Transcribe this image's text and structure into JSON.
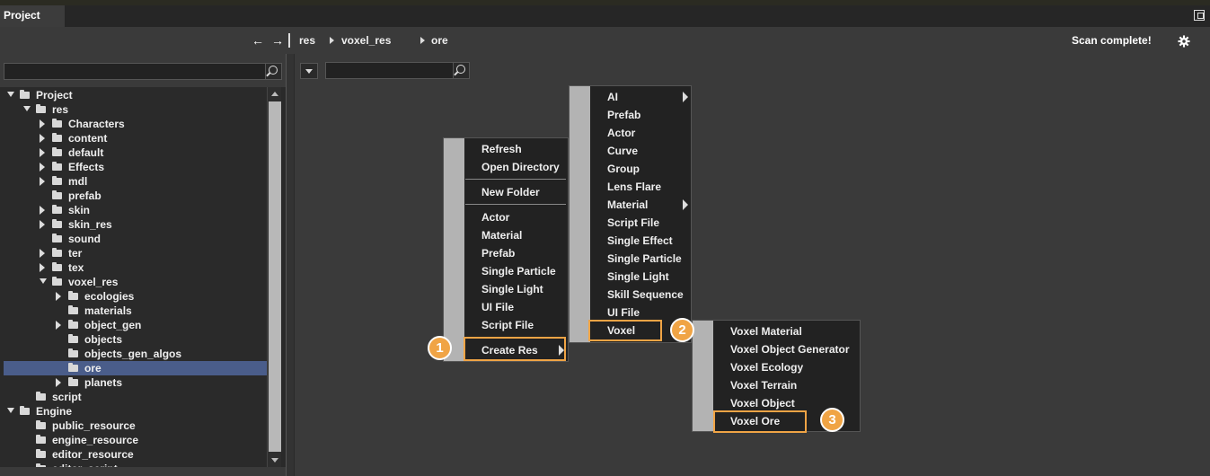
{
  "window": {
    "tab_label": "Project"
  },
  "navbar": {
    "back_glyph": "←",
    "forward_glyph": "→",
    "breadcrumb": [
      "res",
      "voxel_res",
      "ore"
    ],
    "status": "Scan complete!"
  },
  "left_panel": {
    "search_placeholder": "",
    "tree": [
      {
        "label": "Project",
        "depth": 0,
        "expand": "down",
        "folder": "open"
      },
      {
        "label": "res",
        "depth": 1,
        "expand": "down",
        "folder": "open"
      },
      {
        "label": "Characters",
        "depth": 2,
        "expand": "right",
        "folder": "closed"
      },
      {
        "label": "content",
        "depth": 2,
        "expand": "right",
        "folder": "closed"
      },
      {
        "label": "default",
        "depth": 2,
        "expand": "right",
        "folder": "closed"
      },
      {
        "label": "Effects",
        "depth": 2,
        "expand": "right",
        "folder": "closed"
      },
      {
        "label": "mdl",
        "depth": 2,
        "expand": "right",
        "folder": "closed"
      },
      {
        "label": "prefab",
        "depth": 2,
        "expand": "none",
        "folder": "closed"
      },
      {
        "label": "skin",
        "depth": 2,
        "expand": "right",
        "folder": "closed"
      },
      {
        "label": "skin_res",
        "depth": 2,
        "expand": "right",
        "folder": "closed"
      },
      {
        "label": "sound",
        "depth": 2,
        "expand": "none",
        "folder": "closed"
      },
      {
        "label": "ter",
        "depth": 2,
        "expand": "right",
        "folder": "closed"
      },
      {
        "label": "tex",
        "depth": 2,
        "expand": "right",
        "folder": "closed"
      },
      {
        "label": "voxel_res",
        "depth": 2,
        "expand": "down",
        "folder": "open"
      },
      {
        "label": "ecologies",
        "depth": 3,
        "expand": "right",
        "folder": "closed"
      },
      {
        "label": "materials",
        "depth": 3,
        "expand": "none",
        "folder": "closed"
      },
      {
        "label": "object_gen",
        "depth": 3,
        "expand": "right",
        "folder": "closed"
      },
      {
        "label": "objects",
        "depth": 3,
        "expand": "none",
        "folder": "closed"
      },
      {
        "label": "objects_gen_algos",
        "depth": 3,
        "expand": "none",
        "folder": "closed"
      },
      {
        "label": "ore",
        "depth": 3,
        "expand": "none",
        "folder": "open",
        "selected": true
      },
      {
        "label": "planets",
        "depth": 3,
        "expand": "right",
        "folder": "closed"
      },
      {
        "label": "script",
        "depth": 1,
        "expand": "none",
        "folder": "closed"
      },
      {
        "label": "Engine",
        "depth": 0,
        "expand": "down",
        "folder": "open"
      },
      {
        "label": "public_resource",
        "depth": 1,
        "expand": "none",
        "folder": "closed"
      },
      {
        "label": "engine_resource",
        "depth": 1,
        "expand": "none",
        "folder": "closed"
      },
      {
        "label": "editor_resource",
        "depth": 1,
        "expand": "none",
        "folder": "closed"
      },
      {
        "label": "editor_script",
        "depth": 1,
        "expand": "none",
        "folder": "closed"
      }
    ]
  },
  "right_panel": {
    "search_placeholder": ""
  },
  "context_menu": {
    "items": [
      {
        "label": "Refresh"
      },
      {
        "label": "Open Directory"
      },
      {
        "separator": true
      },
      {
        "label": "New Folder"
      },
      {
        "separator": true
      },
      {
        "label": "Actor"
      },
      {
        "label": "Material"
      },
      {
        "label": "Prefab"
      },
      {
        "label": "Single Particle"
      },
      {
        "label": "Single Light"
      },
      {
        "label": "UI File"
      },
      {
        "label": "Script File"
      },
      {
        "separator": true
      },
      {
        "label": "Create Res",
        "submenu": true
      }
    ]
  },
  "create_res_submenu": {
    "items": [
      {
        "label": "AI",
        "submenu": true
      },
      {
        "label": "Prefab"
      },
      {
        "label": "Actor"
      },
      {
        "label": "Curve"
      },
      {
        "label": "Group"
      },
      {
        "label": "Lens Flare"
      },
      {
        "label": "Material",
        "submenu": true
      },
      {
        "label": "Script File"
      },
      {
        "label": "Single Effect"
      },
      {
        "label": "Single Particle"
      },
      {
        "label": "Single Light"
      },
      {
        "label": "Skill Sequence"
      },
      {
        "label": "UI File"
      },
      {
        "label": "Voxel",
        "submenu": true
      }
    ]
  },
  "voxel_submenu": {
    "items": [
      {
        "label": "Voxel Material"
      },
      {
        "label": "Voxel Object Generator"
      },
      {
        "label": "Voxel Ecology"
      },
      {
        "label": "Voxel Terrain"
      },
      {
        "label": "Voxel Object"
      },
      {
        "label": "Voxel Ore"
      }
    ]
  },
  "callouts": [
    "1",
    "2",
    "3"
  ],
  "colors": {
    "accent": "#f0a445",
    "selection": "#4a5d8a",
    "menu_bg": "#222222",
    "menu_gutter": "#b3b3b3"
  }
}
